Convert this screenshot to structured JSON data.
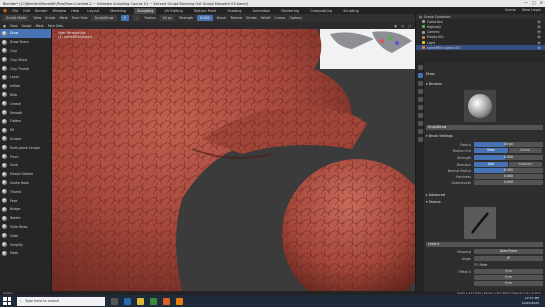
{
  "window": {
    "title": "Blender* [C:\\Blender\\Monolith\\Files\\Raw-Cracked-2 ~ Ultimate Sculpting Course 01 ~ Second Sculpt Blocking Out Sculpt Monolith 03.blend]",
    "controls": [
      "—",
      "□",
      "✕"
    ]
  },
  "menu": {
    "items": [
      "File",
      "Edit",
      "Render",
      "Window",
      "Help"
    ],
    "workspaces": [
      "Layout",
      "Modeling",
      "Sculpting",
      "UV Editing",
      "Texture Paint",
      "Shading",
      "Animation",
      "Rendering",
      "Compositing",
      "Scripting"
    ],
    "active_workspace": "Sculpting",
    "scene": "Scene",
    "view_layer": "View Layer"
  },
  "toolbar": {
    "mode": "Sculpt Mode",
    "items": [
      "View",
      "Sculpt",
      "Mask",
      "Face Sets"
    ],
    "brush": "SculptDraw",
    "radius_label": "Radius",
    "radius": "40 px",
    "strength_label": "Strength",
    "strength": "0.500",
    "add": "+",
    "sub": "-",
    "overlays": [
      "Brush",
      "Texture",
      "Stroke",
      "Falloff",
      "Cursor"
    ],
    "options": "Options"
  },
  "viewport": {
    "info_line1": "User Perspective",
    "info_line2": "(1) cameRRSculpted"
  },
  "brushes": [
    "Draw",
    "Draw Sharp",
    "Clay",
    "Clay Strips",
    "Clay Thumb",
    "Layer",
    "Inflate",
    "Blob",
    "Crease",
    "Smooth",
    "Flatten",
    "Fill",
    "Scrape",
    "Multi-plane Scrape",
    "Pinch",
    "Grab",
    "Elastic Deform",
    "Snake Hook",
    "Thumb",
    "Pose",
    "Nudge",
    "Rotate",
    "Slide Relax",
    "Cloth",
    "Simplify",
    "Mask"
  ],
  "active_brush": "Draw",
  "outliner": {
    "header": "Scene Collection",
    "rows": [
      {
        "name": "Collection",
        "color": "#9a9a9a"
      },
      {
        "name": "Highpoly",
        "color": "#58b35a"
      },
      {
        "name": "Camera",
        "color": "#9a9a9a"
      },
      {
        "name": "Empty.001",
        "color": "#d47b3a"
      },
      {
        "name": "Light",
        "color": "#d9c63b"
      },
      {
        "name": "cameRRSculpted.001",
        "color": "#e47b3b"
      }
    ]
  },
  "properties": {
    "tool_name": "Draw",
    "brushes_section": "Brushes",
    "brush_name": "SculptDraw",
    "brush_settings": "Brush Settings",
    "radius_label": "Radius",
    "radius": "40 px",
    "radius_unit_label": "Radius Unit",
    "radius_unit_options": [
      "View",
      "Scene"
    ],
    "strength_label": "Strength",
    "strength": "0.500",
    "direction_label": "Direction",
    "direction_options": [
      "Add",
      "Subtract"
    ],
    "normal_radius_label": "Normal Radius",
    "normal_radius": "0.500",
    "hardness_label": "Hardness",
    "hardness": "0.000",
    "autosmooth_label": "Autosmooth",
    "autosmooth": "0.000",
    "advanced": "Advanced",
    "texture": "Texture",
    "texture_name": "Level 4",
    "mapping_label": "Mapping",
    "mapping": "Area Plane",
    "angle_label": "Angle",
    "angle": "0°",
    "rake_label": "Rake",
    "offset_label": "Offset X",
    "offset_x": "0 m",
    "offset_y": "0 m",
    "offset_z": "0 m"
  },
  "status": {
    "left": "Select",
    "right": "Verts 1,117,830 | Faces 1,117,828 | Objects 1/6 | 2.90.0"
  },
  "taskbar": {
    "search_placeholder": "Type here to search",
    "time": "12:57 PM",
    "date": "10/20/2020"
  }
}
